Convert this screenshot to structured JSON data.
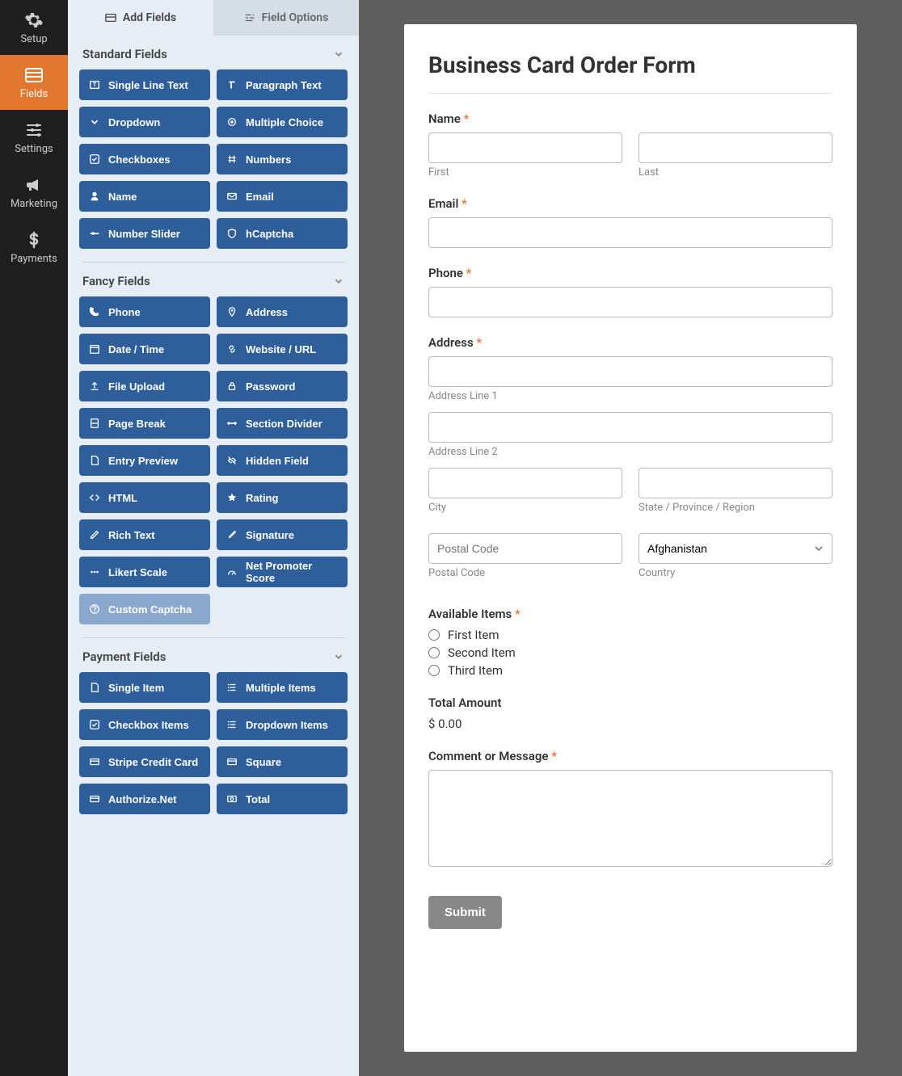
{
  "nav": {
    "items": [
      {
        "label": "Setup",
        "icon": "gear"
      },
      {
        "label": "Fields",
        "icon": "fields"
      },
      {
        "label": "Settings",
        "icon": "sliders"
      },
      {
        "label": "Marketing",
        "icon": "bullhorn"
      },
      {
        "label": "Payments",
        "icon": "dollar"
      }
    ],
    "active": 1
  },
  "tabs": {
    "add": "Add Fields",
    "options": "Field Options"
  },
  "sections": {
    "standard": {
      "title": "Standard Fields",
      "fields": [
        {
          "label": "Single Line Text",
          "icon": "text"
        },
        {
          "label": "Paragraph Text",
          "icon": "paragraph"
        },
        {
          "label": "Dropdown",
          "icon": "chevron-down"
        },
        {
          "label": "Multiple Choice",
          "icon": "radio"
        },
        {
          "label": "Checkboxes",
          "icon": "check"
        },
        {
          "label": "Numbers",
          "icon": "hash"
        },
        {
          "label": "Name",
          "icon": "user"
        },
        {
          "label": "Email",
          "icon": "mail"
        },
        {
          "label": "Number Slider",
          "icon": "slider"
        },
        {
          "label": "hCaptcha",
          "icon": "shield"
        }
      ]
    },
    "fancy": {
      "title": "Fancy Fields",
      "fields": [
        {
          "label": "Phone",
          "icon": "phone"
        },
        {
          "label": "Address",
          "icon": "pin"
        },
        {
          "label": "Date / Time",
          "icon": "calendar"
        },
        {
          "label": "Website / URL",
          "icon": "link"
        },
        {
          "label": "File Upload",
          "icon": "upload"
        },
        {
          "label": "Password",
          "icon": "lock"
        },
        {
          "label": "Page Break",
          "icon": "page"
        },
        {
          "label": "Section Divider",
          "icon": "divider"
        },
        {
          "label": "Entry Preview",
          "icon": "doc"
        },
        {
          "label": "Hidden Field",
          "icon": "eye-off"
        },
        {
          "label": "HTML",
          "icon": "code"
        },
        {
          "label": "Rating",
          "icon": "star"
        },
        {
          "label": "Rich Text",
          "icon": "edit"
        },
        {
          "label": "Signature",
          "icon": "pencil"
        },
        {
          "label": "Likert Scale",
          "icon": "dots"
        },
        {
          "label": "Net Promoter Score",
          "icon": "gauge"
        },
        {
          "label": "Custom Captcha",
          "icon": "question",
          "disabled": true
        }
      ]
    },
    "payment": {
      "title": "Payment Fields",
      "fields": [
        {
          "label": "Single Item",
          "icon": "doc"
        },
        {
          "label": "Multiple Items",
          "icon": "list"
        },
        {
          "label": "Checkbox Items",
          "icon": "check"
        },
        {
          "label": "Dropdown Items",
          "icon": "list"
        },
        {
          "label": "Stripe Credit Card",
          "icon": "card"
        },
        {
          "label": "Square",
          "icon": "card"
        },
        {
          "label": "Authorize.Net",
          "icon": "card"
        },
        {
          "label": "Total",
          "icon": "money"
        }
      ]
    }
  },
  "form": {
    "title": "Business Card Order Form",
    "name": {
      "label": "Name",
      "first": "First",
      "last": "Last"
    },
    "email": {
      "label": "Email"
    },
    "phone": {
      "label": "Phone"
    },
    "address": {
      "label": "Address",
      "line1": "Address Line 1",
      "line2": "Address Line 2",
      "city": "City",
      "state": "State / Province / Region",
      "postal": "Postal Code",
      "postal_placeholder": "Postal Code",
      "country": "Country",
      "country_value": "Afghanistan"
    },
    "items": {
      "label": "Available Items",
      "options": [
        "First Item",
        "Second Item",
        "Third Item"
      ]
    },
    "total": {
      "label": "Total Amount",
      "value": "$ 0.00"
    },
    "comment": {
      "label": "Comment or Message"
    },
    "submit": "Submit"
  }
}
